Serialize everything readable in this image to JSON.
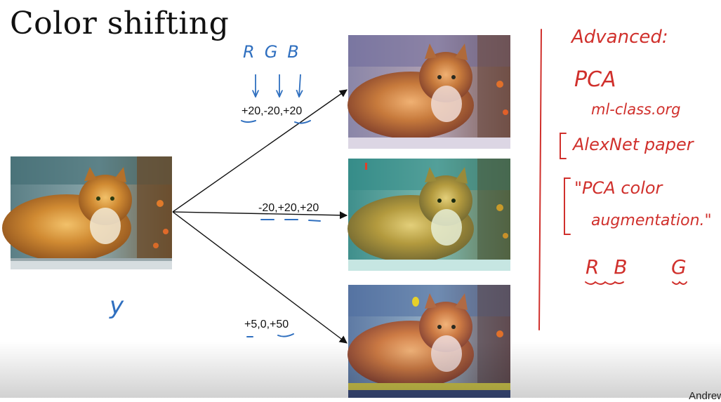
{
  "slide": {
    "title": "Color shifting",
    "author": "Andrew N"
  },
  "annotations": {
    "rgb_letters": [
      "R",
      "G",
      "B"
    ],
    "shift_top": "+20,-20,+20",
    "shift_middle": "-20,+20,+20",
    "shift_bottom": "+5,0,+50",
    "label_y": "y"
  },
  "notes": {
    "line1": "Advanced:",
    "line2": "PCA",
    "line3": "ml-class.org",
    "line4": "AlexNet paper",
    "line5": "\"PCA color",
    "line6": "augmentation.\"",
    "line7_left": "R B",
    "line7_right": "G"
  },
  "colors": {
    "ink_blue": "#2f6fbf",
    "ink_red": "#d0302c",
    "arrow": "#111111"
  },
  "images": [
    {
      "name": "original-cat",
      "tint": "natural"
    },
    {
      "name": "cat-shift-top",
      "tint": "magenta"
    },
    {
      "name": "cat-shift-middle",
      "tint": "cyan-green"
    },
    {
      "name": "cat-shift-bottom",
      "tint": "blue-yellow"
    }
  ]
}
